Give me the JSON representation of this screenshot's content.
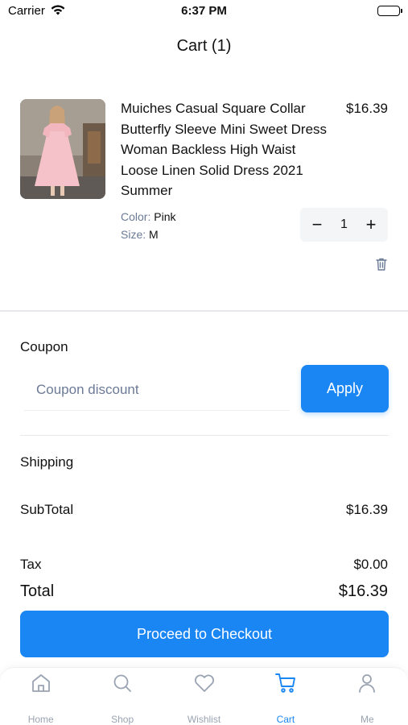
{
  "status_bar": {
    "carrier": "Carrier",
    "time": "6:37 PM"
  },
  "header": {
    "title": "Cart (1)"
  },
  "cart_items": [
    {
      "name": "Muiches Casual Square Collar Butterfly Sleeve Mini Sweet Dress Woman Backless High Waist Loose Linen Solid Dress 2021 Summer",
      "price": "$16.39",
      "color_label": "Color:",
      "color_value": "Pink",
      "size_label": "Size:",
      "size_value": "M",
      "quantity": "1",
      "minus": "−",
      "plus": "+"
    }
  ],
  "coupon": {
    "title": "Coupon",
    "placeholder": "Coupon discount",
    "value": "",
    "apply_label": "Apply"
  },
  "shipping": {
    "title": "Shipping"
  },
  "summary": {
    "subtotal_label": "SubTotal",
    "subtotal_value": "$16.39",
    "tax_label": "Tax",
    "tax_value": "$0.00",
    "total_label": "Total",
    "total_value": "$16.39"
  },
  "checkout": {
    "label": "Proceed to Checkout"
  },
  "tabs": [
    {
      "label": "Home",
      "icon": "home-icon",
      "active": false
    },
    {
      "label": "Shop",
      "icon": "search-icon",
      "active": false
    },
    {
      "label": "Wishlist",
      "icon": "heart-icon",
      "active": false
    },
    {
      "label": "Cart",
      "icon": "cart-icon",
      "active": true
    },
    {
      "label": "Me",
      "icon": "user-icon",
      "active": false
    }
  ],
  "colors": {
    "accent": "#1a86f3",
    "muted": "#6b7a96",
    "tab_inactive": "#9aa3b2",
    "text": "#111111"
  }
}
